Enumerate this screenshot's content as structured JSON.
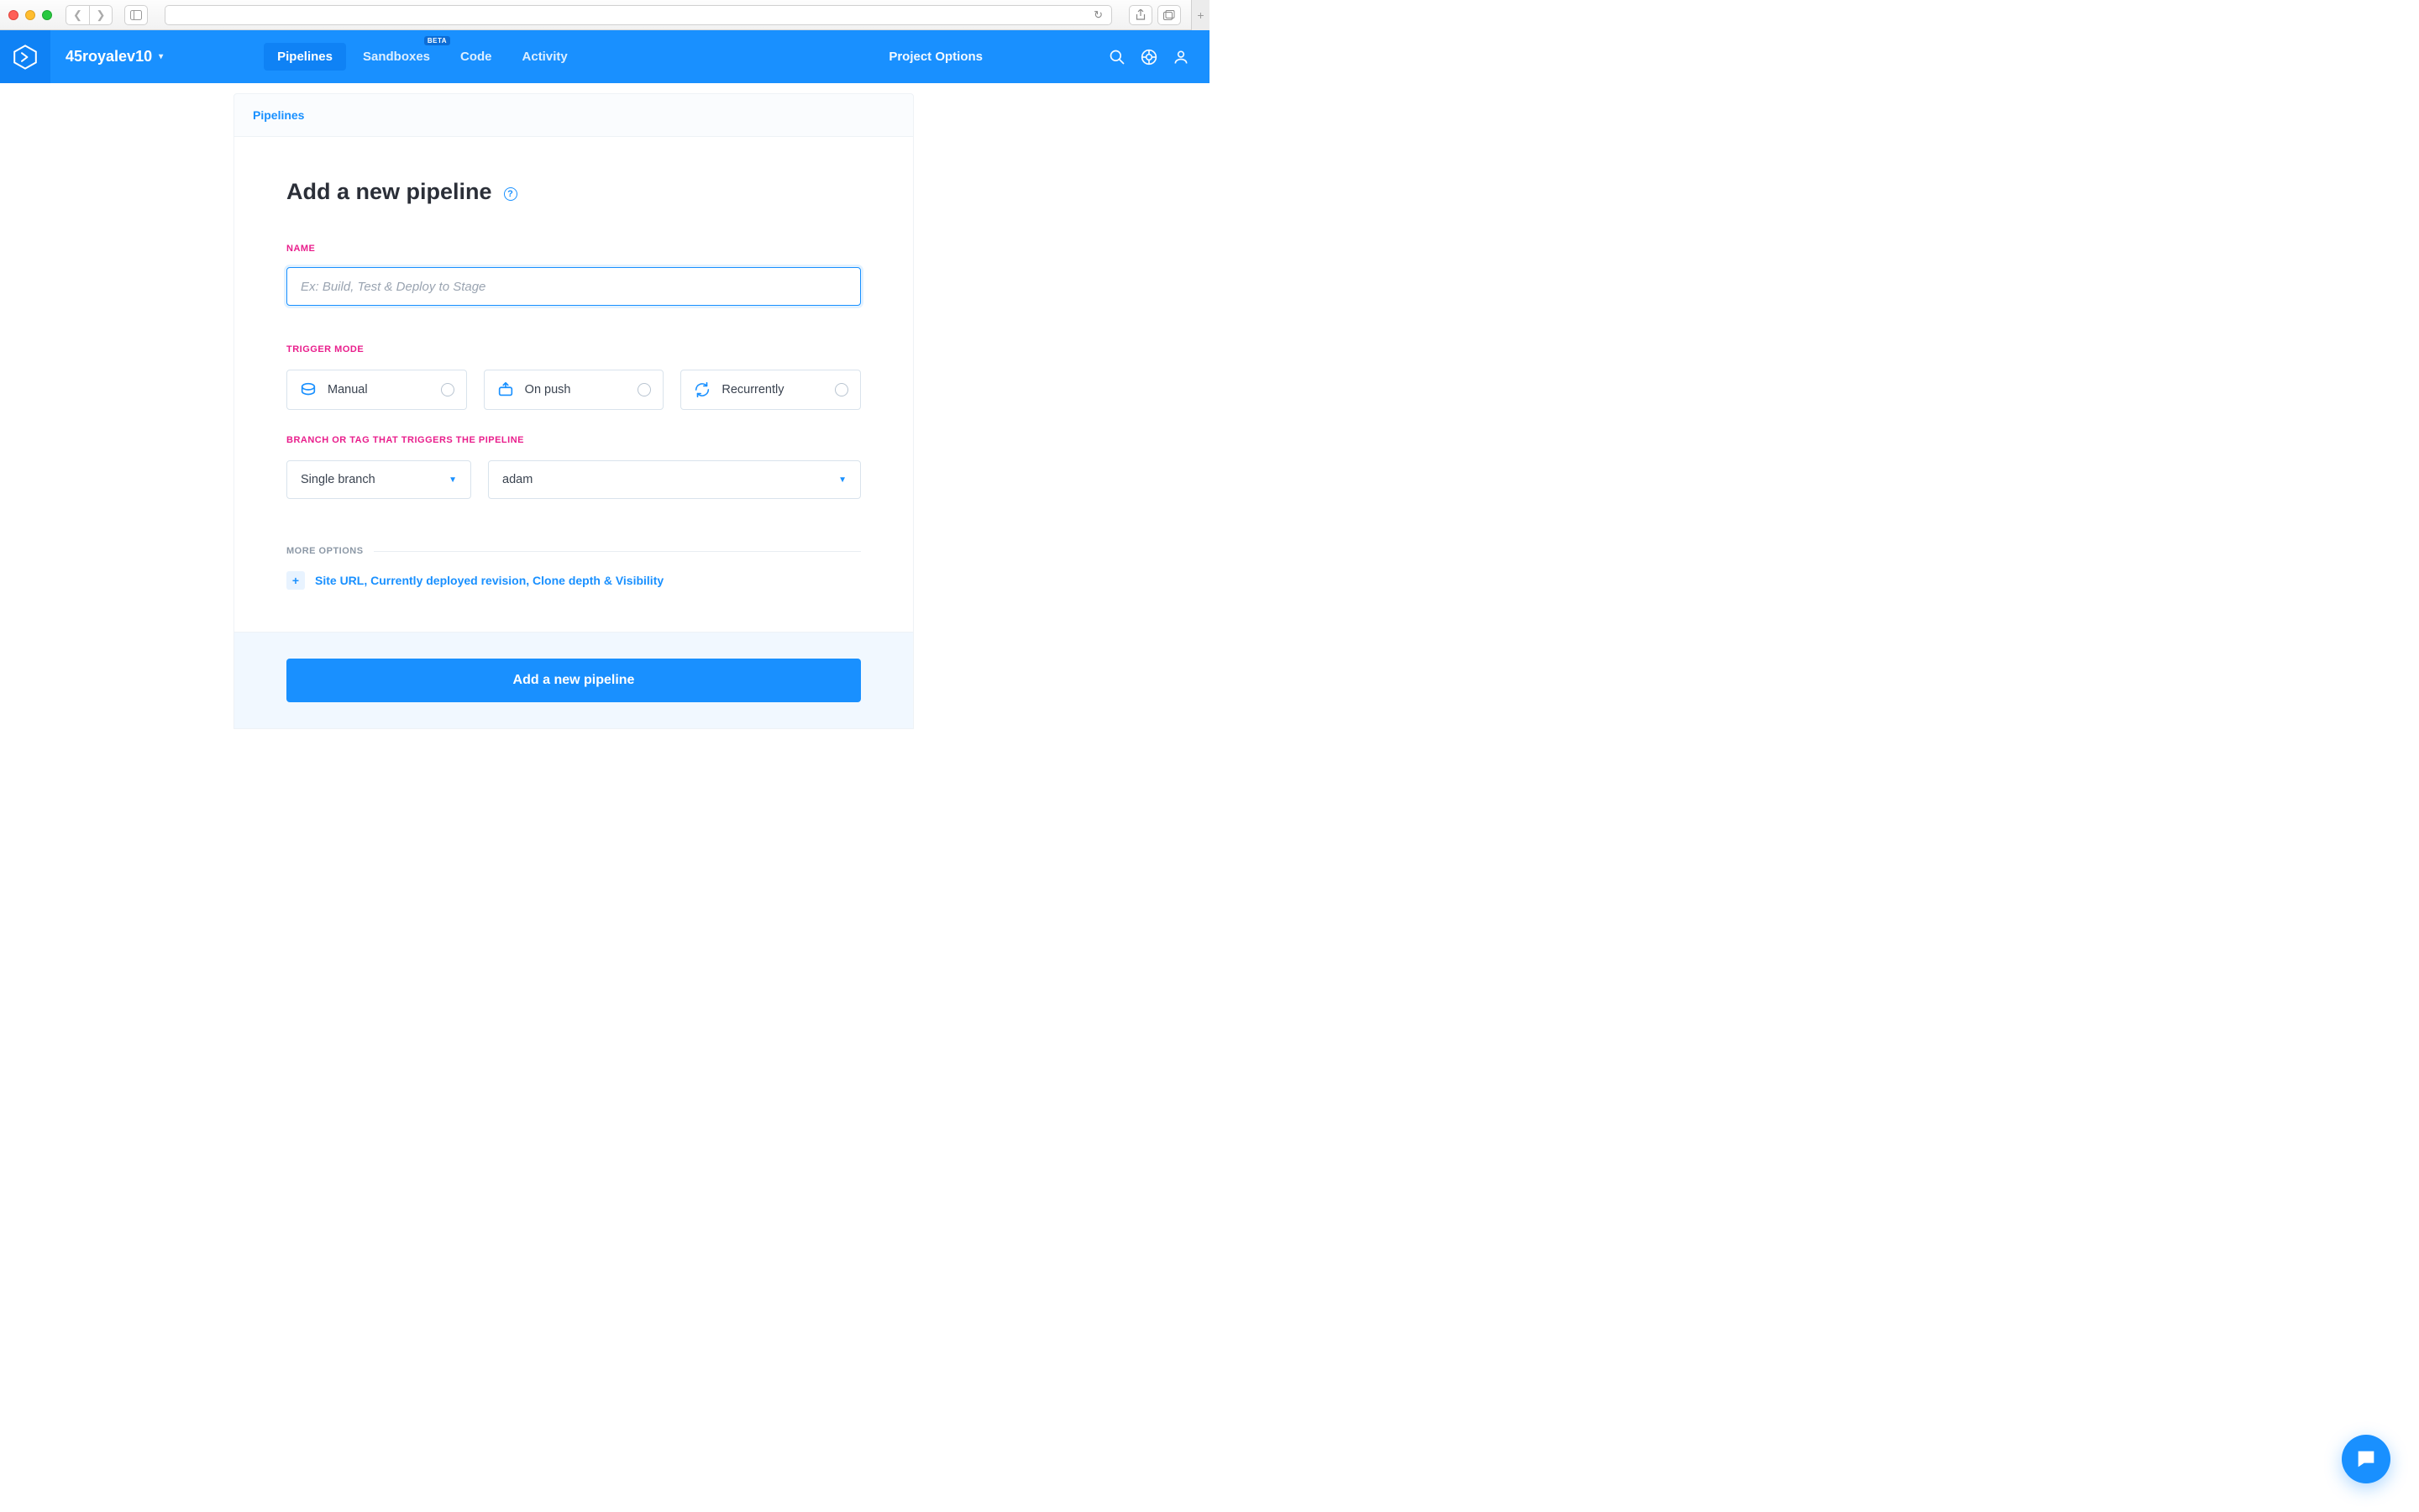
{
  "app": {
    "project_name": "45royalev10",
    "nav": {
      "pipelines": "Pipelines",
      "sandboxes": "Sandboxes",
      "sandboxes_badge": "BETA",
      "code": "Code",
      "activity": "Activity"
    },
    "project_options": "Project Options"
  },
  "breadcrumb": {
    "pipelines": "Pipelines"
  },
  "form": {
    "title": "Add a new pipeline",
    "name_label": "NAME",
    "name_placeholder": "Ex: Build, Test & Deploy to Stage",
    "trigger_label": "TRIGGER MODE",
    "triggers": {
      "manual": "Manual",
      "on_push": "On push",
      "recurrently": "Recurrently"
    },
    "branch_label": "BRANCH OR TAG THAT TRIGGERS THE PIPELINE",
    "branch_mode": "Single branch",
    "branch_value": "adam",
    "more_options_label": "MORE OPTIONS",
    "more_options_link": "Site URL, Currently deployed revision, Clone depth & Visibility",
    "submit": "Add a new pipeline"
  }
}
